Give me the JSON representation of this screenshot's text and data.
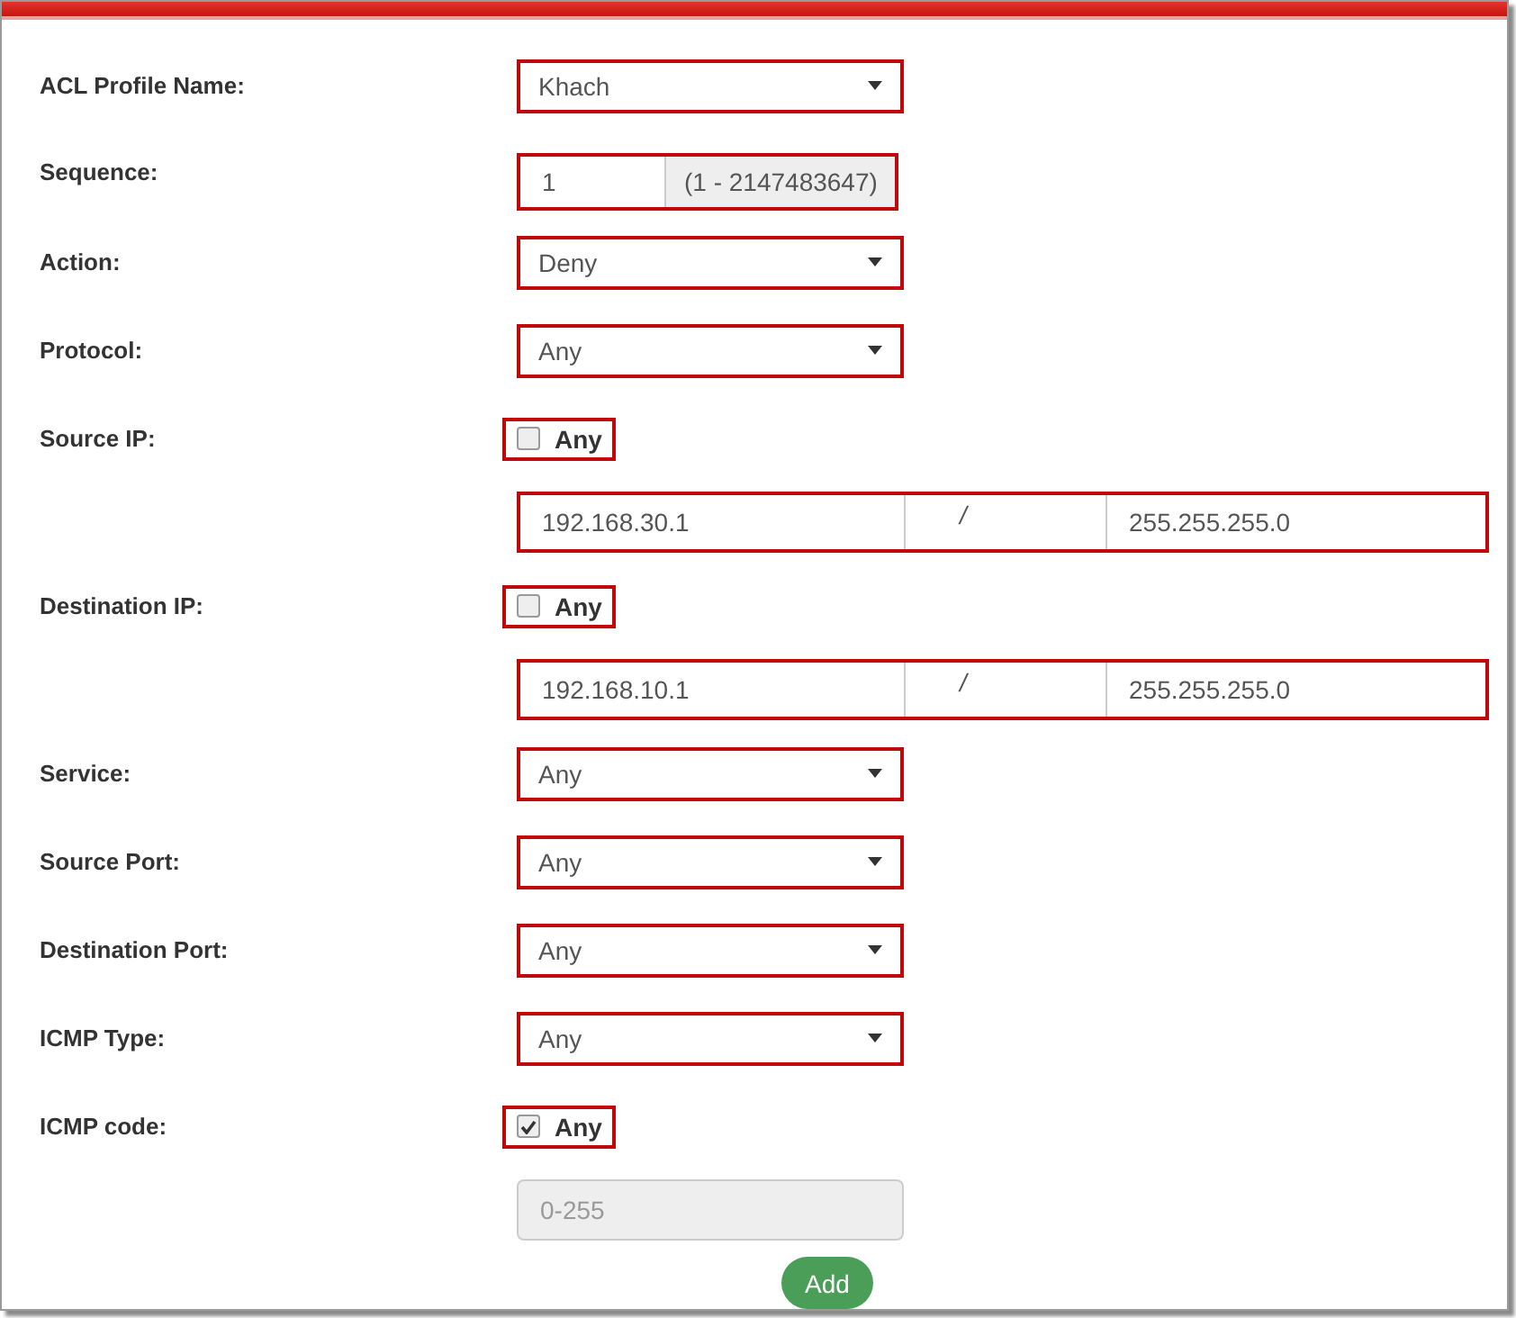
{
  "fields": [
    {
      "kind": "select",
      "label": "ACL Profile Name:",
      "value": "Khach",
      "highlighted": true
    },
    {
      "kind": "sequence",
      "label": "Sequence:",
      "value": "1",
      "hint": "(1 - 2147483647)",
      "highlighted": true
    },
    {
      "kind": "select",
      "label": "Action:",
      "value": "Deny",
      "highlighted": true
    },
    {
      "kind": "select",
      "label": "Protocol:",
      "value": "Any",
      "highlighted": true
    },
    {
      "kind": "checkbox",
      "label": "Source IP:",
      "option": "Any",
      "checked": false,
      "highlighted": true
    },
    {
      "kind": "ip",
      "address": "192.168.30.1",
      "separator": "/",
      "mask": "255.255.255.0",
      "highlighted": true
    },
    {
      "kind": "checkbox",
      "label": "Destination IP:",
      "option": "Any",
      "checked": false,
      "highlighted": true
    },
    {
      "kind": "ip",
      "address": "192.168.10.1",
      "separator": "/",
      "mask": "255.255.255.0",
      "highlighted": true
    },
    {
      "kind": "select",
      "label": "Service:",
      "value": "Any",
      "highlighted": true
    },
    {
      "kind": "select",
      "label": "Source Port:",
      "value": "Any",
      "highlighted": true
    },
    {
      "kind": "select",
      "label": "Destination Port:",
      "value": "Any",
      "highlighted": true
    },
    {
      "kind": "select",
      "label": "ICMP Type:",
      "value": "Any",
      "highlighted": true
    },
    {
      "kind": "checkbox",
      "label": "ICMP code:",
      "option": "Any",
      "checked": true,
      "highlighted": true
    },
    {
      "kind": "disabled-input",
      "placeholder": "0-255"
    }
  ],
  "add_button": "Add"
}
